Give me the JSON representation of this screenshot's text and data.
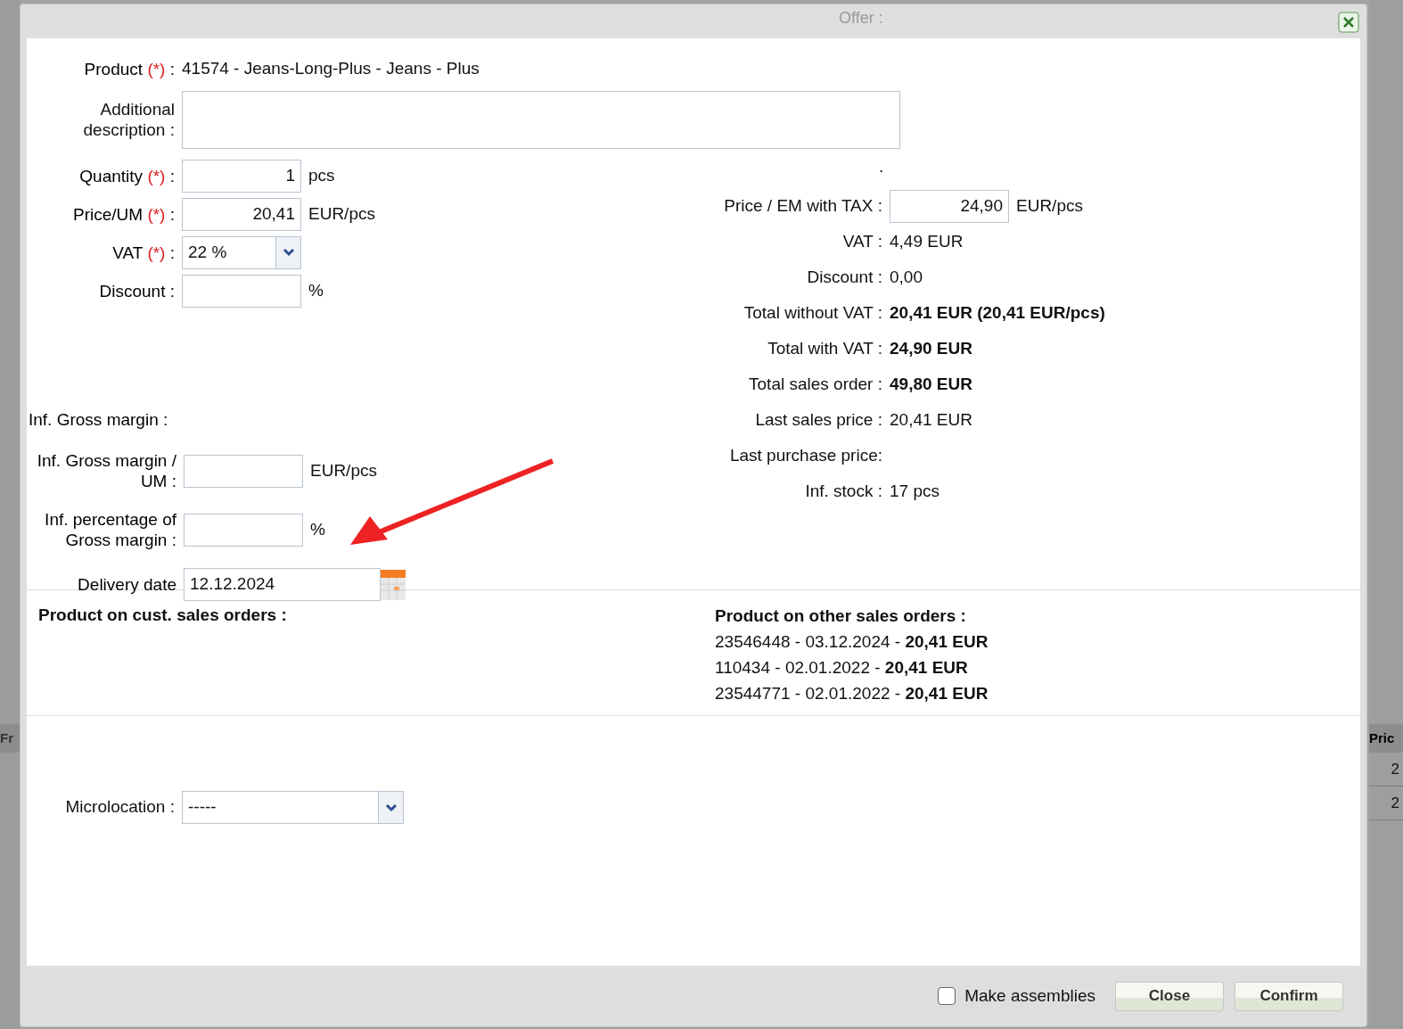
{
  "background": {
    "offer_label": "Offer :",
    "left_column_heading": "Fr",
    "right_column_heading": "Pric",
    "right_cells": [
      "2",
      "2"
    ]
  },
  "product": {
    "label": "Product",
    "required_mark": "(*)",
    "separator": ":",
    "value": "41574 - Jeans-Long-Plus - Jeans - Plus"
  },
  "additional_description": {
    "label": "Additional description :"
  },
  "left_fields": [
    {
      "kind": "input",
      "label": "Quantity",
      "required_mark": "(*)",
      "separator": ":",
      "value": "1",
      "unit": "pcs"
    },
    {
      "kind": "input",
      "label": "Price/UM",
      "required_mark": "(*)",
      "separator": ":",
      "value": "20,41",
      "unit": "EUR/pcs"
    },
    {
      "kind": "select",
      "label": "VAT",
      "required_mark": "(*)",
      "separator": ":",
      "value": "22 %"
    },
    {
      "kind": "input",
      "label": "Discount :",
      "unit": "%"
    }
  ],
  "lower_left_fields": [
    {
      "kind": "text",
      "label": "Inf. Gross margin :"
    },
    {
      "kind": "input",
      "label": "Inf. Gross margin / UM :",
      "unit": "EUR/pcs"
    },
    {
      "kind": "input",
      "label": "Inf. percentage of Gross margin :",
      "unit": "%"
    },
    {
      "kind": "date",
      "label": "Delivery date",
      "value": "12.12.2024"
    }
  ],
  "right_marker": ".",
  "price_with_tax": {
    "label": "Price / EM with TAX :",
    "value": "24,90",
    "unit": "EUR/pcs"
  },
  "right_fields": [
    {
      "label": "VAT :",
      "value": "4,49 EUR",
      "bold": false
    },
    {
      "label": "Discount :",
      "value": "0,00",
      "bold": false
    },
    {
      "label": "Total without VAT :",
      "value": "20,41 EUR (20,41 EUR/pcs)",
      "bold": true
    },
    {
      "label": "Total with VAT :",
      "value": "24,90 EUR",
      "bold": true
    },
    {
      "label": "Total sales order :",
      "value": "49,80 EUR",
      "bold": true
    },
    {
      "label": "Last sales price :",
      "value": "20,41 EUR",
      "bold": false
    },
    {
      "label": "Last purchase price:",
      "bold": false
    },
    {
      "label": "Inf. stock :",
      "value": "17 pcs",
      "bold": false
    }
  ],
  "cust_orders": {
    "title": "Product on cust. sales orders :"
  },
  "other_orders": {
    "title": "Product on other sales orders :",
    "lines": [
      "23546448 - 03.12.2024 - **20,41 EUR**",
      "110434 - 02.01.2022 - **20,41 EUR**",
      "23544771 - 02.01.2022 - **20,41 EUR**"
    ]
  },
  "microlocation": {
    "label": "Microlocation :",
    "value": "-----"
  },
  "footer": {
    "make_assemblies": {
      "label": "Make assemblies",
      "checked": false
    },
    "buttons": [
      "Close",
      "Confirm"
    ]
  }
}
